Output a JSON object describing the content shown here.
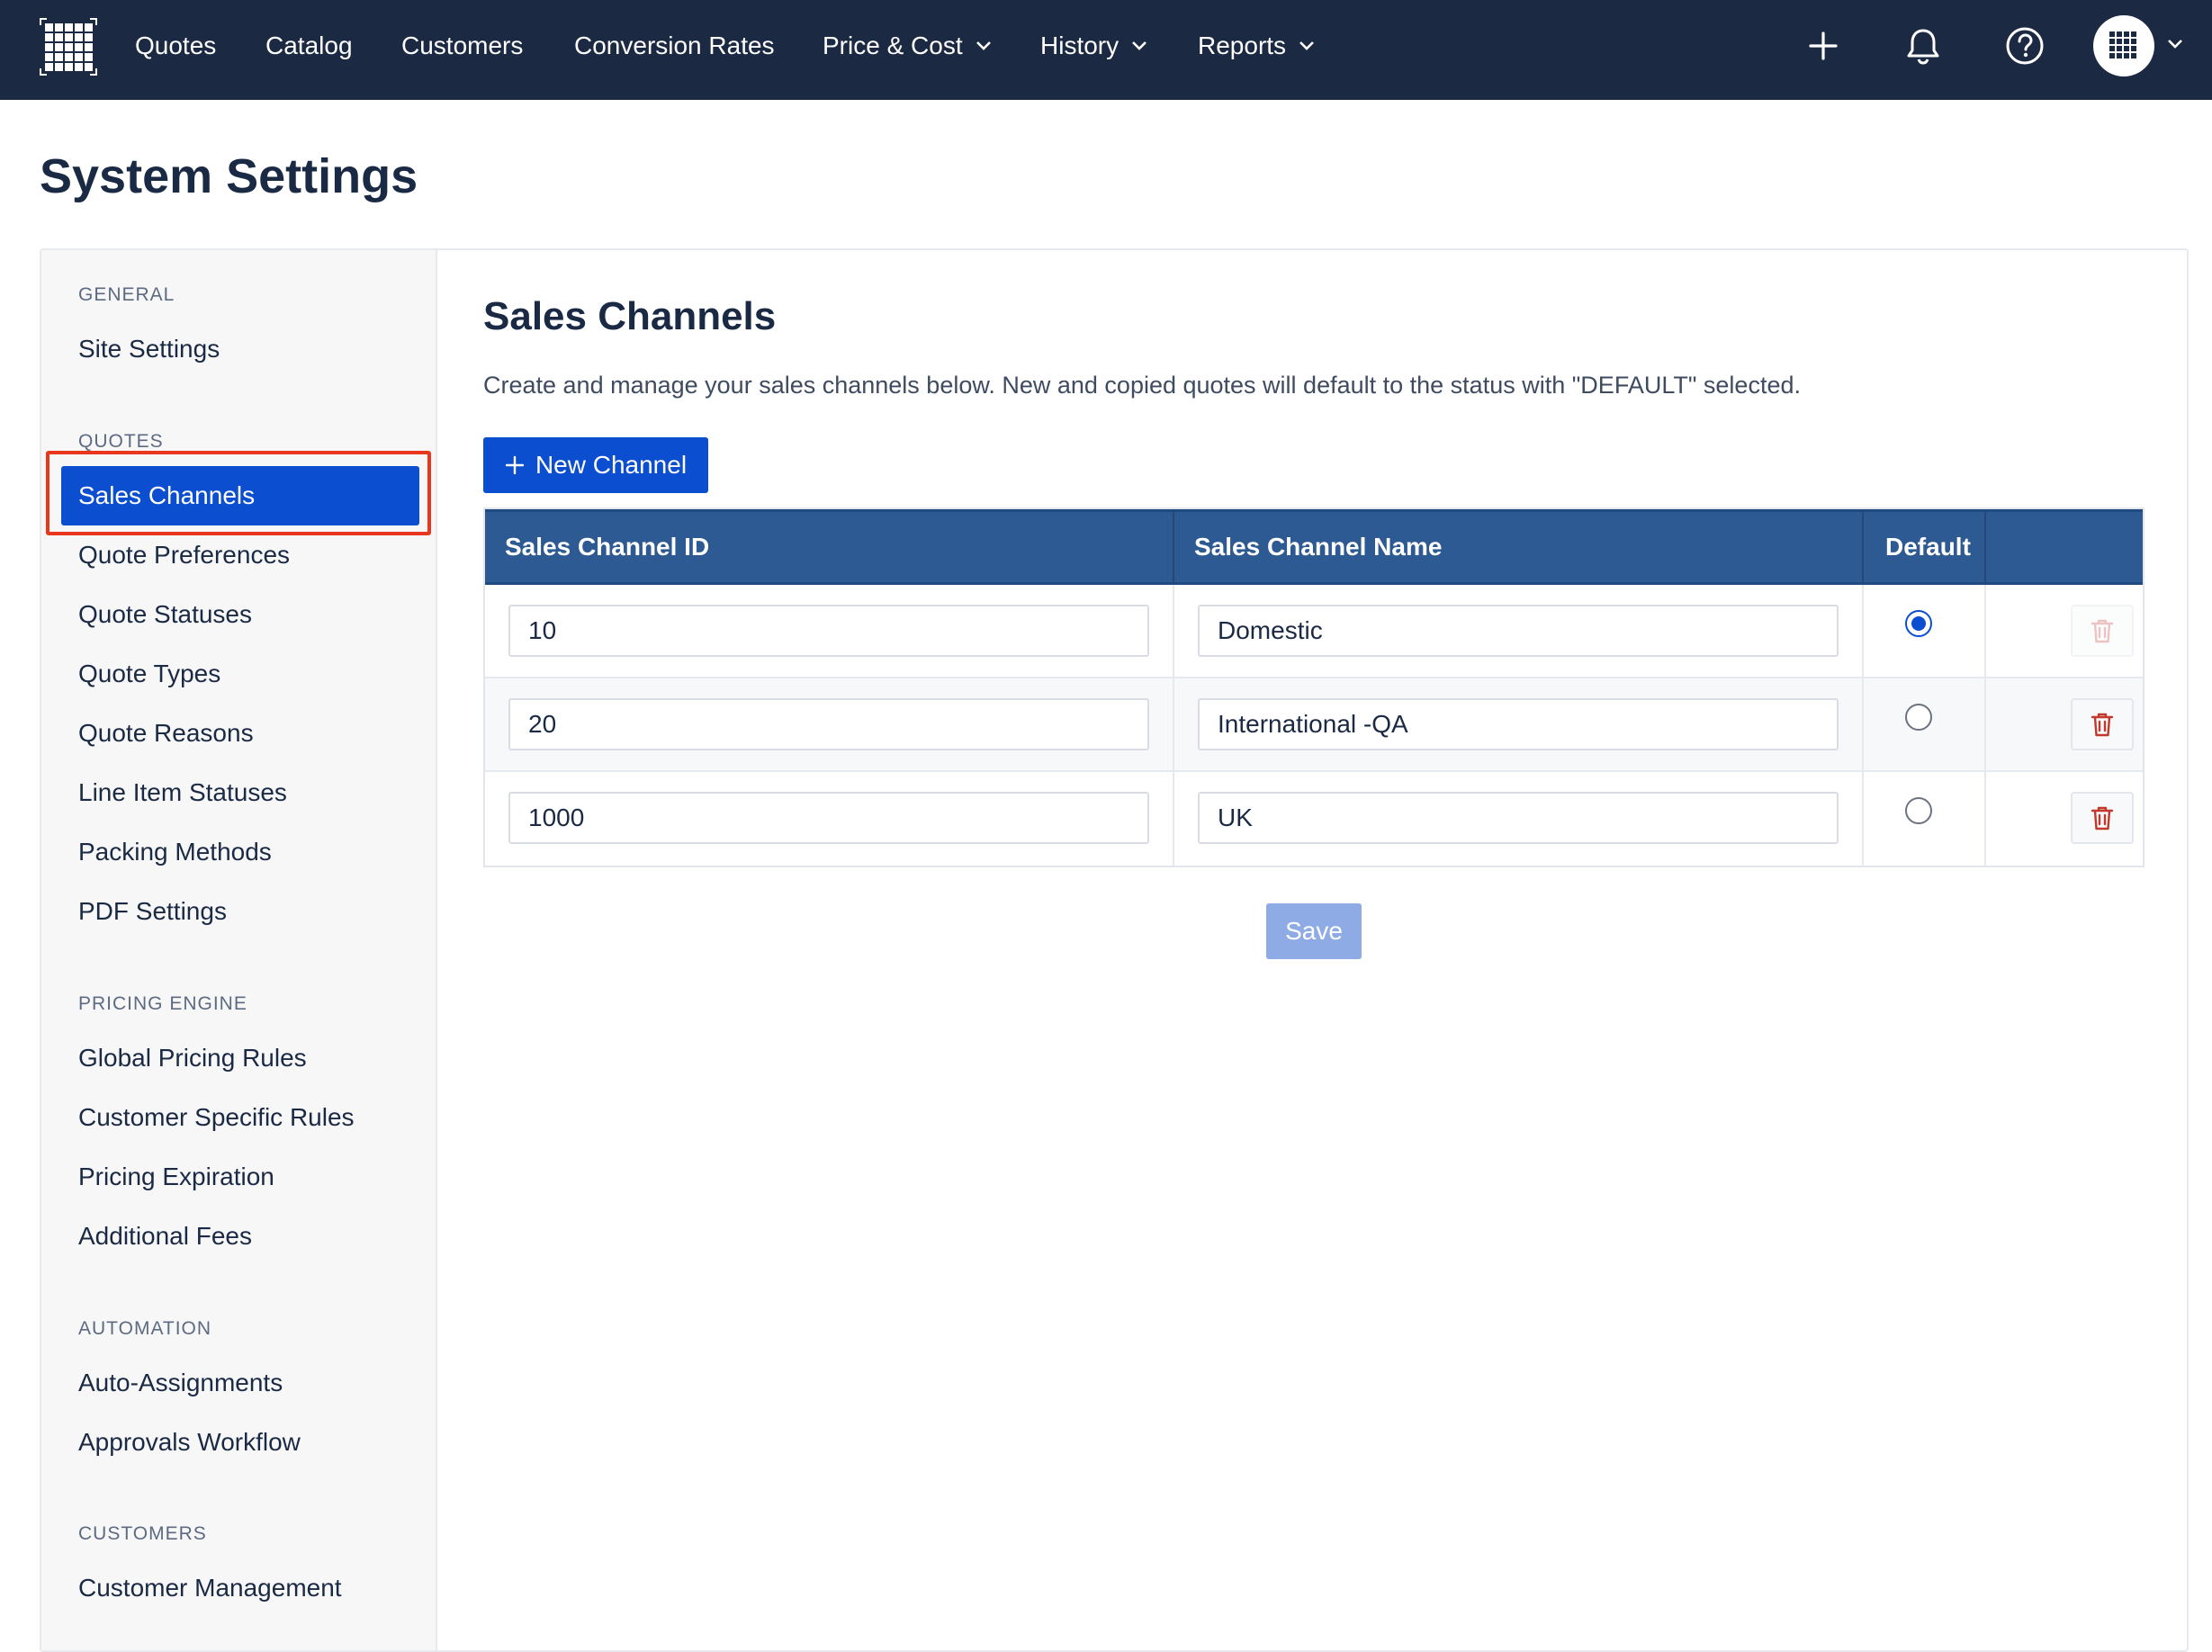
{
  "nav": {
    "items": [
      {
        "label": "Quotes"
      },
      {
        "label": "Catalog"
      },
      {
        "label": "Customers"
      },
      {
        "label": "Conversion Rates"
      },
      {
        "label": "Price & Cost"
      },
      {
        "label": "History"
      },
      {
        "label": "Reports"
      }
    ],
    "icons": [
      "plus-icon",
      "bell-icon",
      "help-icon",
      "avatar-grid-icon",
      "chevron-down-icon"
    ]
  },
  "page": {
    "title": "System Settings"
  },
  "sidebar": {
    "sections": [
      {
        "label": "GENERAL",
        "items": [
          "Site Settings"
        ]
      },
      {
        "label": "QUOTES",
        "items": [
          "Sales Channels",
          "Quote Preferences",
          "Quote Statuses",
          "Quote Types",
          "Quote Reasons",
          "Line Item Statuses",
          "Packing Methods",
          "PDF Settings"
        ]
      },
      {
        "label": "PRICING ENGINE",
        "items": [
          "Global Pricing Rules",
          "Customer Specific Rules",
          "Pricing Expiration",
          "Additional Fees"
        ]
      },
      {
        "label": "AUTOMATION",
        "items": [
          "Auto-Assignments",
          "Approvals Workflow"
        ]
      },
      {
        "label": "CUSTOMERS",
        "items": [
          "Customer Management"
        ]
      }
    ],
    "active_item": "Sales Channels"
  },
  "main": {
    "title": "Sales Channels",
    "description": "Create and manage your sales channels below. New and copied quotes will default to the status with \"DEFAULT\" selected.",
    "new_button_label": "New Channel",
    "table": {
      "headers": [
        "Sales Channel ID",
        "Sales Channel Name",
        "Default",
        ""
      ],
      "rows": [
        {
          "id": "10",
          "name": "Domestic",
          "default": true
        },
        {
          "id": "20",
          "name": "International -QA",
          "default": false
        },
        {
          "id": "1000",
          "name": "UK",
          "default": false
        }
      ]
    },
    "save_label": "Save"
  },
  "colors": {
    "nav_bg": "#1b2943",
    "primary": "#0b4fd0",
    "table_header": "#2d5a92",
    "highlight": "#e8371c",
    "delete_icon": "#c0392b",
    "save_disabled": "#8eabe6"
  }
}
